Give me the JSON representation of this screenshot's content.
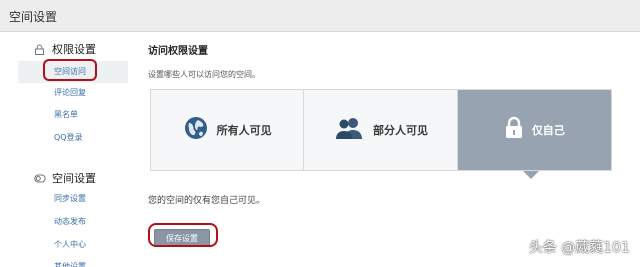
{
  "window": {
    "title": "空间设置"
  },
  "sidebar": {
    "sections": [
      {
        "title": "权限设置",
        "icon": "lock-icon",
        "items": [
          {
            "label": "空间访问",
            "active": true
          },
          {
            "label": "评论回复"
          },
          {
            "label": "黑名单"
          },
          {
            "label": "QQ登录"
          }
        ]
      },
      {
        "title": "空间设置",
        "icon": "toggle-icon",
        "items": [
          {
            "label": "同步设置"
          },
          {
            "label": "动态发布"
          },
          {
            "label": "个人中心"
          },
          {
            "label": "其他设置"
          }
        ]
      }
    ]
  },
  "main": {
    "title": "访问权限设置",
    "description": "设置哪些人可以访问您的空间。",
    "options": [
      {
        "label": "所有人可见",
        "icon": "globe-icon",
        "selected": false
      },
      {
        "label": "部分人可见",
        "icon": "people-icon",
        "selected": false
      },
      {
        "label": "仅自己",
        "icon": "lock-icon",
        "selected": true
      }
    ],
    "status": "您的空间的仅有您自己可见。",
    "save_label": "保存设置"
  },
  "watermark": {
    "text": "头条 @葳蕤101"
  },
  "colors": {
    "accent": "#97a3b0",
    "link": "#3a6ea8",
    "highlight": "#b3101a"
  }
}
